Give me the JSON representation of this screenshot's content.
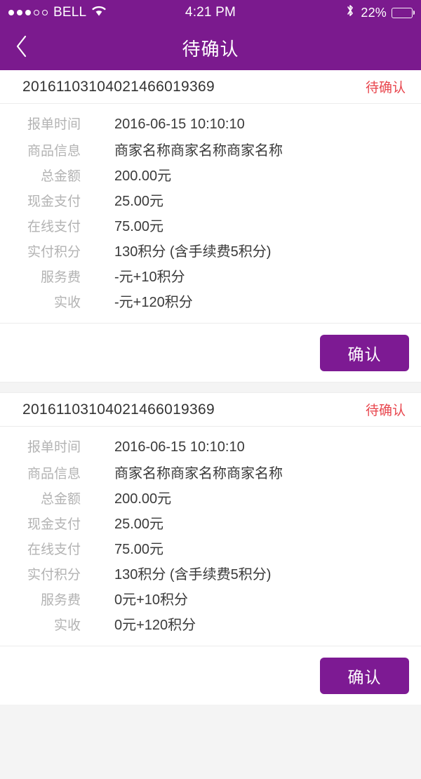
{
  "status_bar": {
    "carrier": "BELL",
    "signal_dots_filled": 3,
    "signal_dots_total": 5,
    "wifi_icon": "wifi-icon",
    "time": "4:21 PM",
    "bluetooth_icon": "bluetooth-icon",
    "battery_percent_label": "22%",
    "battery_level": 22
  },
  "nav": {
    "back_icon": "chevron-left-icon",
    "title": "待确认"
  },
  "colors": {
    "brand_purple": "#7b1a8e",
    "button_purple": "#7d1a93",
    "status_red": "#e8464e",
    "page_background": "#f4f4f4",
    "card_background": "#ffffff",
    "label_gray": "#b3b3b3",
    "value_dark": "#3a3a3a"
  },
  "cards": [
    {
      "order_no": "20161103104021466019369",
      "status": "待确认",
      "rows": [
        {
          "label": "报单时间",
          "value": "2016-06-15  10:10:10"
        },
        {
          "label": "商品信息",
          "value": "商家名称商家名称商家名称"
        },
        {
          "label": "总金额",
          "value": "200.00元"
        },
        {
          "label": "现金支付",
          "value": "25.00元"
        },
        {
          "label": "在线支付",
          "value": "75.00元"
        },
        {
          "label": "实付积分",
          "value": "130积分 (含手续费5积分)"
        },
        {
          "label": "服务费",
          "value": "-元+10积分"
        },
        {
          "label": "实收",
          "value": "-元+120积分"
        }
      ],
      "confirm_label": "确认"
    },
    {
      "order_no": "20161103104021466019369",
      "status": "待确认",
      "rows": [
        {
          "label": "报单时间",
          "value": "2016-06-15  10:10:10"
        },
        {
          "label": "商品信息",
          "value": "商家名称商家名称商家名称"
        },
        {
          "label": "总金额",
          "value": "200.00元"
        },
        {
          "label": "现金支付",
          "value": "25.00元"
        },
        {
          "label": "在线支付",
          "value": "75.00元"
        },
        {
          "label": "实付积分",
          "value": "130积分 (含手续费5积分)"
        },
        {
          "label": "服务费",
          "value": "0元+10积分"
        },
        {
          "label": "实收",
          "value": "0元+120积分"
        }
      ],
      "confirm_label": "确认"
    }
  ]
}
